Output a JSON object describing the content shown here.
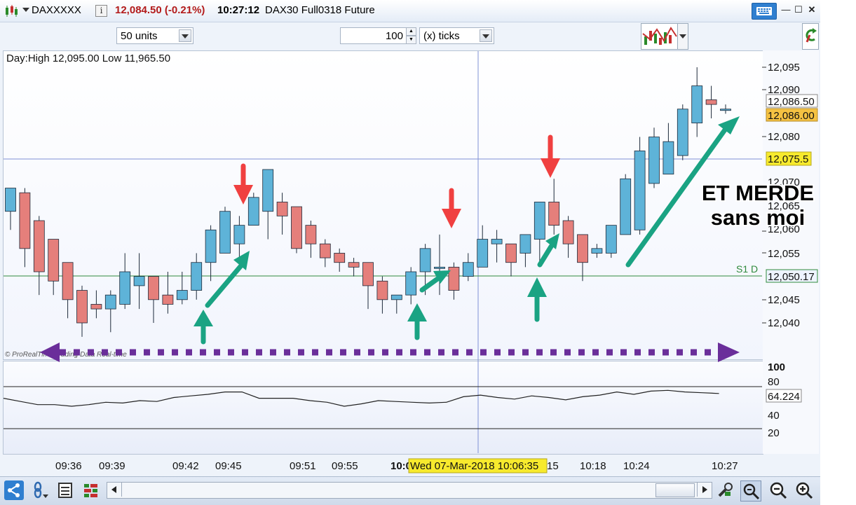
{
  "window": {
    "symbol": "DAXXXXX",
    "last_price": "12,084.50 (-0.21%)",
    "time": "10:27:12",
    "description": "DAX30 Full0318 Future"
  },
  "toolbar": {
    "units": "50 units",
    "ticks_value": "100",
    "ticks_unit": "(x) ticks"
  },
  "chart": {
    "day_range": "Day:High 12,095.00 Low 11,965.50",
    "copyright": "© ProRealTime Trading Data Real-time",
    "annotation_line1": "ET MERDE",
    "annotation_line2": "sans moi",
    "support_label": "S1 D",
    "crosshair_date": "Wed 07-Mar-2018 10:06:35",
    "y_ticks": [
      "12,095",
      "12,090",
      "12,080",
      "12,070",
      "12,065",
      "12,060",
      "12,055",
      "12,045",
      "12,040"
    ],
    "price_tags": {
      "current_high": "12,086.50",
      "current": "12,086.00",
      "crosshair": "12,075.5",
      "support": "12,050.17"
    },
    "x_ticks": [
      "09:36",
      "09:39",
      "09:42",
      "09:45",
      "09:51",
      "09:55",
      "10:0",
      "15",
      "10:18",
      "10:24",
      "10:27"
    ]
  },
  "oscillator": {
    "y_ticks": [
      "100",
      "80",
      "40",
      "20"
    ],
    "value": "64.224"
  },
  "colors": {
    "bull": "#5eb3d8",
    "bear": "#e57f7b",
    "green_arrow": "#1aa383",
    "red_arrow": "#f04040",
    "purple": "#6a2e9a",
    "tag_yellow": "#f7ea2d",
    "tag_orange": "#f5c242"
  },
  "chart_data": {
    "type": "candlestick",
    "unit_interval": "1 minute bars (time labels shown)",
    "y_range": [
      12035,
      12097
    ],
    "candles": [
      {
        "o": 12064,
        "h": 12067,
        "l": 12060,
        "c": 12069
      },
      {
        "o": 12068,
        "h": 12069,
        "l": 12052,
        "c": 12056
      },
      {
        "o": 12062,
        "h": 12063,
        "l": 12046,
        "c": 12051
      },
      {
        "o": 12058,
        "h": 12058,
        "l": 12046,
        "c": 12049
      },
      {
        "o": 12053,
        "h": 12053,
        "l": 12041,
        "c": 12045
      },
      {
        "o": 12047,
        "h": 12048,
        "l": 12037,
        "c": 12040
      },
      {
        "o": 12044,
        "h": 12047,
        "l": 12041,
        "c": 12043
      },
      {
        "o": 12043,
        "h": 12047,
        "l": 12038,
        "c": 12046
      },
      {
        "o": 12044,
        "h": 12055,
        "l": 12043,
        "c": 12051
      },
      {
        "o": 12048,
        "h": 12055,
        "l": 12043,
        "c": 12050
      },
      {
        "o": 12050,
        "h": 12050,
        "l": 12040,
        "c": 12045
      },
      {
        "o": 12046,
        "h": 12051,
        "l": 12042,
        "c": 12044
      },
      {
        "o": 12045,
        "h": 12051,
        "l": 12044,
        "c": 12047
      },
      {
        "o": 12047,
        "h": 12055,
        "l": 12045,
        "c": 12053
      },
      {
        "o": 12053,
        "h": 12061,
        "l": 12049,
        "c": 12060
      },
      {
        "o": 12055,
        "h": 12065,
        "l": 12055,
        "c": 12064
      },
      {
        "o": 12057,
        "h": 12063,
        "l": 12054,
        "c": 12061
      },
      {
        "o": 12061,
        "h": 12068,
        "l": 12061,
        "c": 12067
      },
      {
        "o": 12064,
        "h": 12066,
        "l": 12058,
        "c": 12073
      },
      {
        "o": 12066,
        "h": 12068,
        "l": 12059,
        "c": 12063
      },
      {
        "o": 12065,
        "h": 12065,
        "l": 12055,
        "c": 12056
      },
      {
        "o": 12061,
        "h": 12062,
        "l": 12054,
        "c": 12057
      },
      {
        "o": 12057,
        "h": 12058,
        "l": 12052,
        "c": 12054
      },
      {
        "o": 12055,
        "h": 12056,
        "l": 12051,
        "c": 12053
      },
      {
        "o": 12053,
        "h": 12054,
        "l": 12050,
        "c": 12052
      },
      {
        "o": 12053,
        "h": 12053,
        "l": 12043,
        "c": 12048
      },
      {
        "o": 12049,
        "h": 12050,
        "l": 12042,
        "c": 12045
      },
      {
        "o": 12045,
        "h": 12046,
        "l": 12042,
        "c": 12046
      },
      {
        "o": 12046,
        "h": 12052,
        "l": 12044,
        "c": 12051
      },
      {
        "o": 12051,
        "h": 12057,
        "l": 12046,
        "c": 12056
      },
      {
        "o": 12052,
        "h": 12059,
        "l": 12046,
        "c": 12052
      },
      {
        "o": 12052,
        "h": 12053,
        "l": 12045,
        "c": 12047
      },
      {
        "o": 12050,
        "h": 12055,
        "l": 12049,
        "c": 12053
      },
      {
        "o": 12052,
        "h": 12061,
        "l": 12052,
        "c": 12058
      },
      {
        "o": 12057,
        "h": 12060,
        "l": 12053,
        "c": 12058
      },
      {
        "o": 12057,
        "h": 12057,
        "l": 12050,
        "c": 12053
      },
      {
        "o": 12055,
        "h": 12059,
        "l": 12052,
        "c": 12059
      },
      {
        "o": 12058,
        "h": 12066,
        "l": 12052,
        "c": 12066
      },
      {
        "o": 12066,
        "h": 12071,
        "l": 12059,
        "c": 12061
      },
      {
        "o": 12062,
        "h": 12063,
        "l": 12054,
        "c": 12057
      },
      {
        "o": 12059,
        "h": 12059,
        "l": 12049,
        "c": 12053
      },
      {
        "o": 12055,
        "h": 12057,
        "l": 12054,
        "c": 12056
      },
      {
        "o": 12055,
        "h": 12061,
        "l": 12054,
        "c": 12061
      },
      {
        "o": 12059,
        "h": 12072,
        "l": 12059,
        "c": 12071
      },
      {
        "o": 12060,
        "h": 12080,
        "l": 12059,
        "c": 12077
      },
      {
        "o": 12070,
        "h": 12082,
        "l": 12069,
        "c": 12080
      },
      {
        "o": 12072,
        "h": 12083,
        "l": 12072,
        "c": 12079
      },
      {
        "o": 12076,
        "h": 12087,
        "l": 12075,
        "c": 12086
      },
      {
        "o": 12083,
        "h": 12095,
        "l": 12080,
        "c": 12091
      },
      {
        "o": 12088,
        "h": 12091,
        "l": 12084,
        "c": 12087
      },
      {
        "o": 12086,
        "h": 12087,
        "l": 12085,
        "c": 12086
      }
    ],
    "oscillator_line": [
      58,
      54,
      50,
      50,
      48,
      50,
      53,
      52,
      55,
      54,
      59,
      61,
      63,
      66,
      66,
      58,
      58,
      58,
      55,
      53,
      48,
      51,
      55,
      54,
      53,
      52,
      53,
      60,
      62,
      59,
      57,
      61,
      59,
      56,
      60,
      62,
      66,
      63,
      67,
      68,
      66,
      65,
      64
    ]
  }
}
